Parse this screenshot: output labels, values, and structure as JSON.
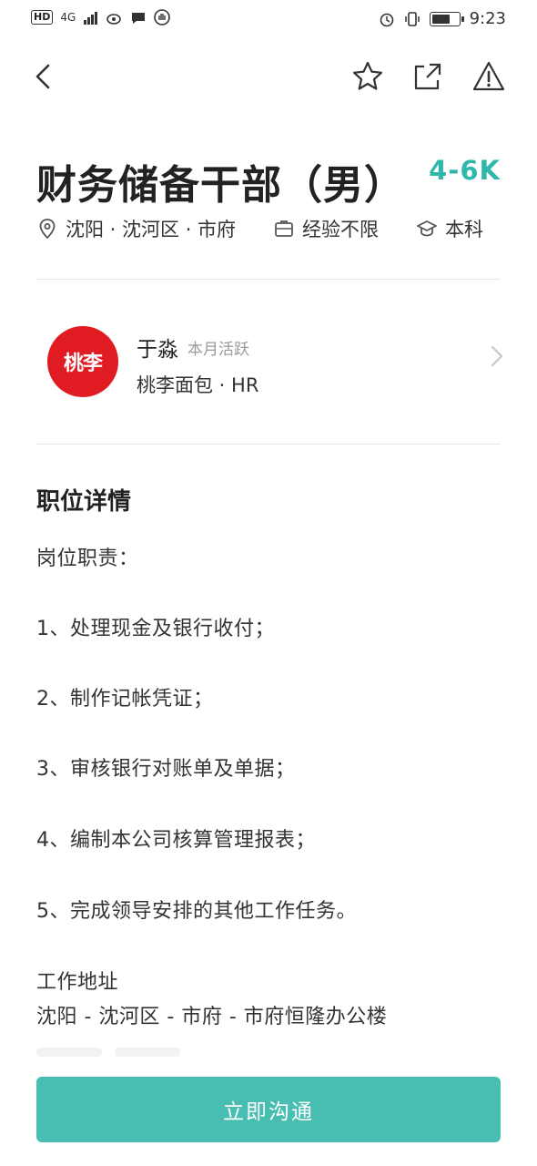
{
  "status_bar": {
    "network_badge": "HD",
    "network_type": "4G",
    "time": "9:23"
  },
  "job": {
    "title": "财务储备干部（男）",
    "salary": "4-6K",
    "location": "沈阳 · 沈河区 · 市府",
    "experience": "经验不限",
    "education": "本科"
  },
  "recruiter": {
    "logo_text": "桃李",
    "name": "于淼",
    "activity": "本月活跃",
    "company_role": "桃李面包 · HR"
  },
  "details": {
    "section_title": "职位详情",
    "duties_heading": "岗位职责：",
    "duties": [
      "1、处理现金及银行收付；",
      "2、制作记帐凭证；",
      "3、审核银行对账单及单据；",
      "4、编制本公司核算管理报表；",
      "5、完成领导安排的其他工作任务。"
    ],
    "address_heading": "工作地址",
    "address": "沈阳 - 沈河区 - 市府 - 市府恒隆办公楼"
  },
  "cta": {
    "label": "立即沟通"
  },
  "colors": {
    "accent": "#2fb7ac",
    "cta_bg": "#48bdb2",
    "logo_bg": "#e11b22"
  },
  "icons": [
    "back-arrow-icon",
    "star-icon",
    "share-icon",
    "report-warning-icon",
    "location-pin-icon",
    "briefcase-icon",
    "graduation-cap-icon",
    "chevron-right-icon"
  ]
}
